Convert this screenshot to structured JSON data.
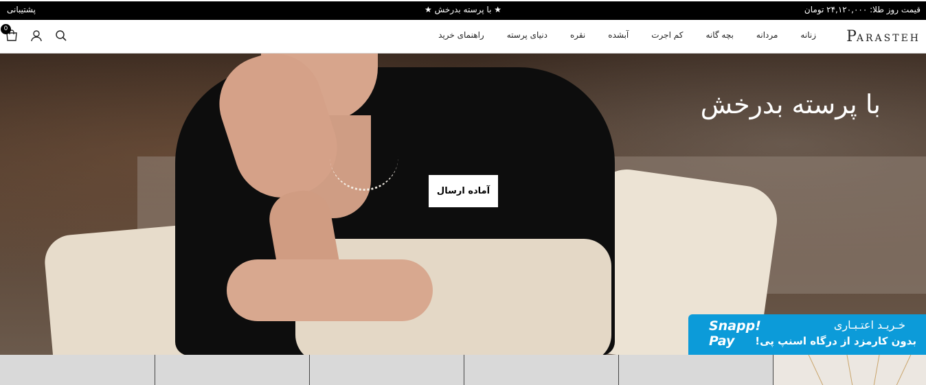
{
  "topbar": {
    "gold_price": "قیمت روز طلا: ۲۴,۱۲۰,۰۰۰ تومان",
    "promo": "★ با پرسته بدرخش ★",
    "support": "پشتیبانی"
  },
  "nav": {
    "logo_initial": "P",
    "logo_rest": "ARASTEH",
    "menu": [
      "زنانه",
      "مردانه",
      "بچه گانه",
      "کم اجرت",
      "آبشده",
      "نقره",
      "دنیای پرسته",
      "راهنمای خرید"
    ],
    "cart_count": "0",
    "icons": [
      "search-icon",
      "user-icon",
      "cart-icon"
    ]
  },
  "hero": {
    "title": "با پرسته بدرخش",
    "button": "آماده ارسال"
  },
  "snapp": {
    "logo_line1": "Snapp!",
    "logo_line2": "Pay",
    "line1": "خـریـد اعتـبـاری",
    "line2": "بدون کارمزد از درگاه اسنپ پی!",
    "color": "#0c9bd9"
  },
  "colors": {
    "topbar_bg": "#000000",
    "button_bg": "#ffffff"
  }
}
